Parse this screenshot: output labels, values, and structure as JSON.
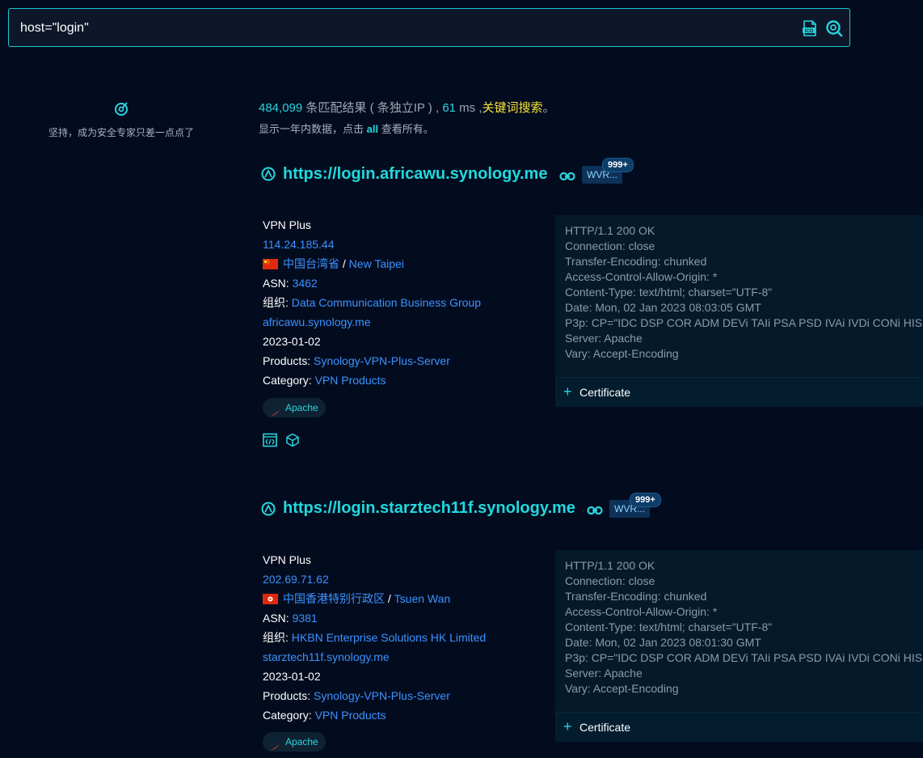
{
  "search": {
    "value": "host=\"login\""
  },
  "sidebar": {
    "tip": "坚持，成为安全专家只差一点点了"
  },
  "stats": {
    "count": "484,099",
    "matched": "条匹配结果 ( 条独立IP ) ,",
    "ms_value": "61",
    "ms_unit": "ms ,",
    "keyword": "关键词搜索",
    "period": "。",
    "sub_prefix": "显示一年内数据，点击",
    "sub_all": "all",
    "sub_suffix": "查看所有。"
  },
  "results": [
    {
      "url": "https://login.africawu.synology.me",
      "tag": "WVR...",
      "badge": "999+",
      "title": "VPN Plus",
      "ip": "114.24.185.44",
      "region": "中国台湾省",
      "sep": "/",
      "city": "New Taipei",
      "asn_label": "ASN:",
      "asn": "3462",
      "org_label": "组织:",
      "org": "Data Communication Business Group",
      "domain": "africawu.synology.me",
      "date": "2023-01-02",
      "products_label": "Products:",
      "product": "Synology-VPN-Plus-Server",
      "category_label": "Category:",
      "category": "VPN Products",
      "server_pill": "Apache",
      "response": "HTTP/1.1 200 OK\nConnection: close\nTransfer-Encoding: chunked\nAccess-Control-Allow-Origin: *\nContent-Type: text/html; charset=\"UTF-8\"\nDate: Mon, 02 Jan 2023 08:03:05 GMT\nP3p: CP=\"IDC DSP COR ADM DEVi TAIi PSA PSD IVAi IVDi CONi HIS\nServer: Apache\nVary: Accept-Encoding",
      "certificate": "Certificate"
    },
    {
      "url": "https://login.starztech11f.synology.me",
      "tag": "WVR...",
      "badge": "999+",
      "title": "VPN Plus",
      "ip": "202.69.71.62",
      "region": "中国香港特别行政区",
      "sep": "/",
      "city": "Tsuen Wan",
      "asn_label": "ASN:",
      "asn": "9381",
      "org_label": "组织:",
      "org": "HKBN Enterprise Solutions HK Limited",
      "domain": "starztech11f.synology.me",
      "date": "2023-01-02",
      "products_label": "Products:",
      "product": "Synology-VPN-Plus-Server",
      "category_label": "Category:",
      "category": "VPN Products",
      "server_pill": "Apache",
      "response": "HTTP/1.1 200 OK\nConnection: close\nTransfer-Encoding: chunked\nAccess-Control-Allow-Origin: *\nContent-Type: text/html; charset=\"UTF-8\"\nDate: Mon, 02 Jan 2023 08:01:30 GMT\nP3p: CP=\"IDC DSP COR ADM DEVi TAIi PSA PSD IVAi IVDi CONi HIS\nServer: Apache\nVary: Accept-Encoding",
      "certificate": "Certificate"
    }
  ],
  "colors": {
    "accent": "#21d8dc",
    "link": "#3c92ff",
    "keyword": "#f5e23a",
    "background": "#030c1f"
  }
}
